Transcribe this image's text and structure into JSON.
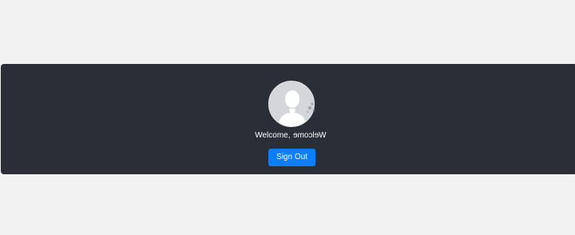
{
  "profile": {
    "welcome_prefix": "Welcome, ",
    "welcome_mirrored": "Welcome",
    "avatar_icon": "default-user-avatar-icon",
    "loading_icon": "loading-spinner-icon"
  },
  "actions": {
    "sign_out_label": "Sign Out"
  },
  "colors": {
    "page_background": "#f2f2f2",
    "panel_background": "#292e37",
    "button_background": "#0d7ef5",
    "avatar_background": "#d4d6da"
  }
}
